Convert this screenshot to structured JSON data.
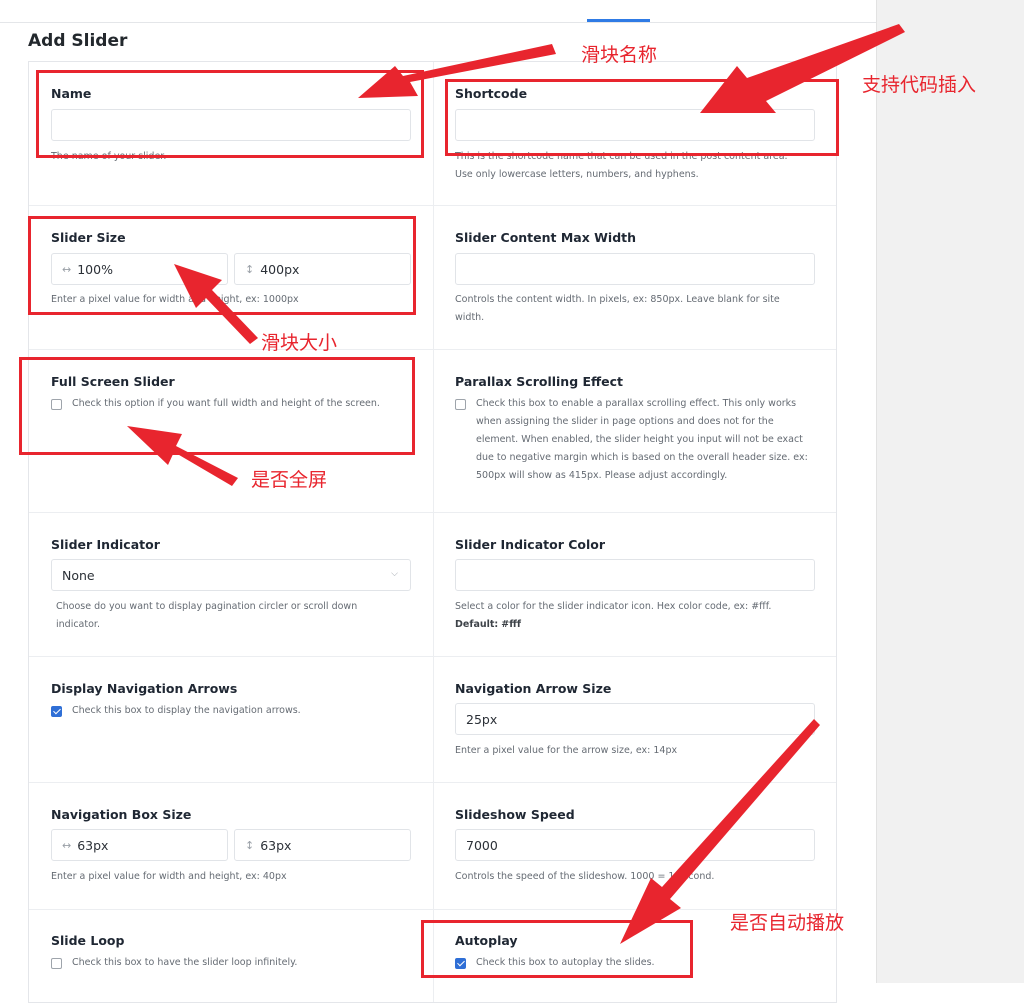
{
  "page": {
    "title": "Add Slider"
  },
  "fields": {
    "name": {
      "label": "Name",
      "value": "",
      "help": "The name of your slider."
    },
    "shortcode": {
      "label": "Shortcode",
      "value": "",
      "help": "This is the shortcode name that can be used in the post content area. Use only lowercase letters, numbers, and hyphens."
    },
    "slider_size": {
      "label": "Slider Size",
      "width": "100%",
      "height": "400px",
      "help": "Enter a pixel value for width and height, ex: 1000px"
    },
    "content_max_width": {
      "label": "Slider Content Max Width",
      "value": "",
      "help": "Controls the content width. In pixels, ex: 850px. Leave blank for site width."
    },
    "full_screen": {
      "label": "Full Screen Slider",
      "checked": false,
      "help": "Check this option if you want full width and height of the screen."
    },
    "parallax": {
      "label": "Parallax Scrolling Effect",
      "checked": false,
      "help": "Check this box to enable a parallax scrolling effect. This only works when assigning the slider in page options and does not for the element. When enabled, the slider height you input will not be exact due to negative margin which is based on the overall header size. ex: 500px will show as 415px. Please adjust accordingly."
    },
    "indicator": {
      "label": "Slider Indicator",
      "value": "None",
      "help": "Choose do you want to display pagination circler or scroll down indicator."
    },
    "indicator_color": {
      "label": "Slider Indicator Color",
      "value": "",
      "help": "Select a color for the slider indicator icon. Hex color code, ex: #fff.",
      "default_label": "Default:",
      "default_value": "#fff"
    },
    "nav_arrows": {
      "label": "Display Navigation Arrows",
      "checked": true,
      "help": "Check this box to display the navigation arrows."
    },
    "nav_arrow_size": {
      "label": "Navigation Arrow Size",
      "value": "25px",
      "help": "Enter a pixel value for the arrow size, ex: 14px"
    },
    "nav_box_size": {
      "label": "Navigation Box Size",
      "width": "63px",
      "height": "63px",
      "help": "Enter a pixel value for width and height, ex: 40px"
    },
    "slideshow_speed": {
      "label": "Slideshow Speed",
      "value": "7000",
      "help": "Controls the speed of the slideshow. 1000 = 1 second."
    },
    "slide_loop": {
      "label": "Slide Loop",
      "checked": false,
      "help": "Check this box to have the slider loop infinitely."
    },
    "autoplay": {
      "label": "Autoplay",
      "checked": true,
      "help": "Check this box to autoplay the slides."
    }
  },
  "annotations": {
    "name": "滑块名称",
    "shortcode": "支持代码插入",
    "size": "滑块大小",
    "fullscreen": "是否全屏",
    "autoplay": "是否自动播放"
  },
  "icons": {
    "width": "horizontal-arrows-icon",
    "height": "vertical-arrows-icon",
    "dropdown": "chevron-down-icon"
  },
  "colors": {
    "annotation_red": "#e8252e",
    "checkbox_blue": "#2f6fd6",
    "tab_blue": "#2f7be5"
  }
}
